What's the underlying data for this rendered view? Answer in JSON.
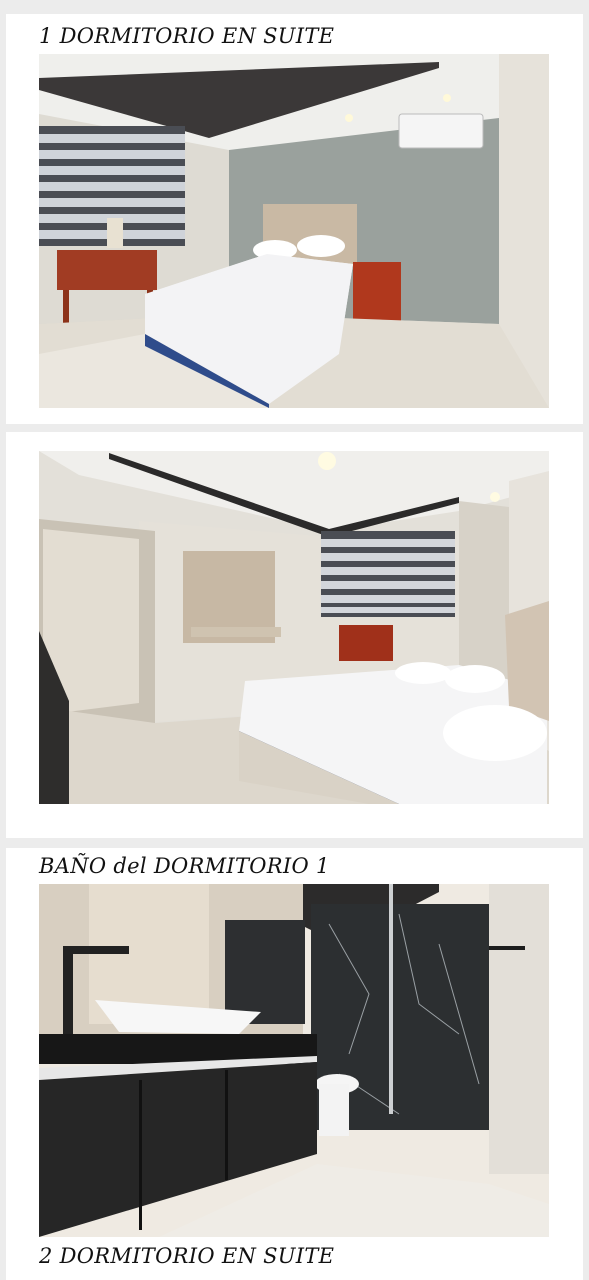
{
  "sections": [
    {
      "heading": "1 DORMITORIO EN SUITE",
      "photos": [
        {
          "icon": "bedroom-photo-icon"
        },
        {
          "icon": "bedroom-photo-icon"
        }
      ]
    },
    {
      "heading": "BAÑO del DORMITORIO 1",
      "photos": [
        {
          "icon": "bathroom-photo-icon"
        }
      ]
    },
    {
      "heading": "2 DORMITORIO EN SUITE"
    }
  ],
  "colors": {
    "page_background": "#ececec",
    "card_background": "#ffffff",
    "heading_text": "#111111"
  }
}
